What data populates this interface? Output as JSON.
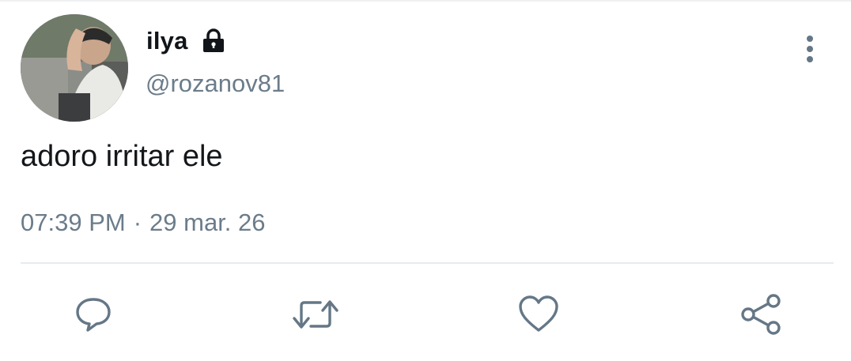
{
  "tweet": {
    "display_name": "ilya",
    "handle": "@rozanov81",
    "text": "adoro irritar ele",
    "time": "07:39 PM",
    "separator": "·",
    "date": "29 mar. 26",
    "protected_icon": "lock-icon",
    "menu_icon": "more-vertical-icon"
  },
  "actions": [
    {
      "name": "reply",
      "icon": "reply-icon"
    },
    {
      "name": "retweet",
      "icon": "retweet-icon"
    },
    {
      "name": "like",
      "icon": "heart-icon"
    },
    {
      "name": "share",
      "icon": "share-icon"
    }
  ],
  "colors": {
    "name": "#111418",
    "secondary": "#6b7c8a",
    "text": "#14171a",
    "icon": "#657786",
    "divider": "#e6ecf0"
  }
}
